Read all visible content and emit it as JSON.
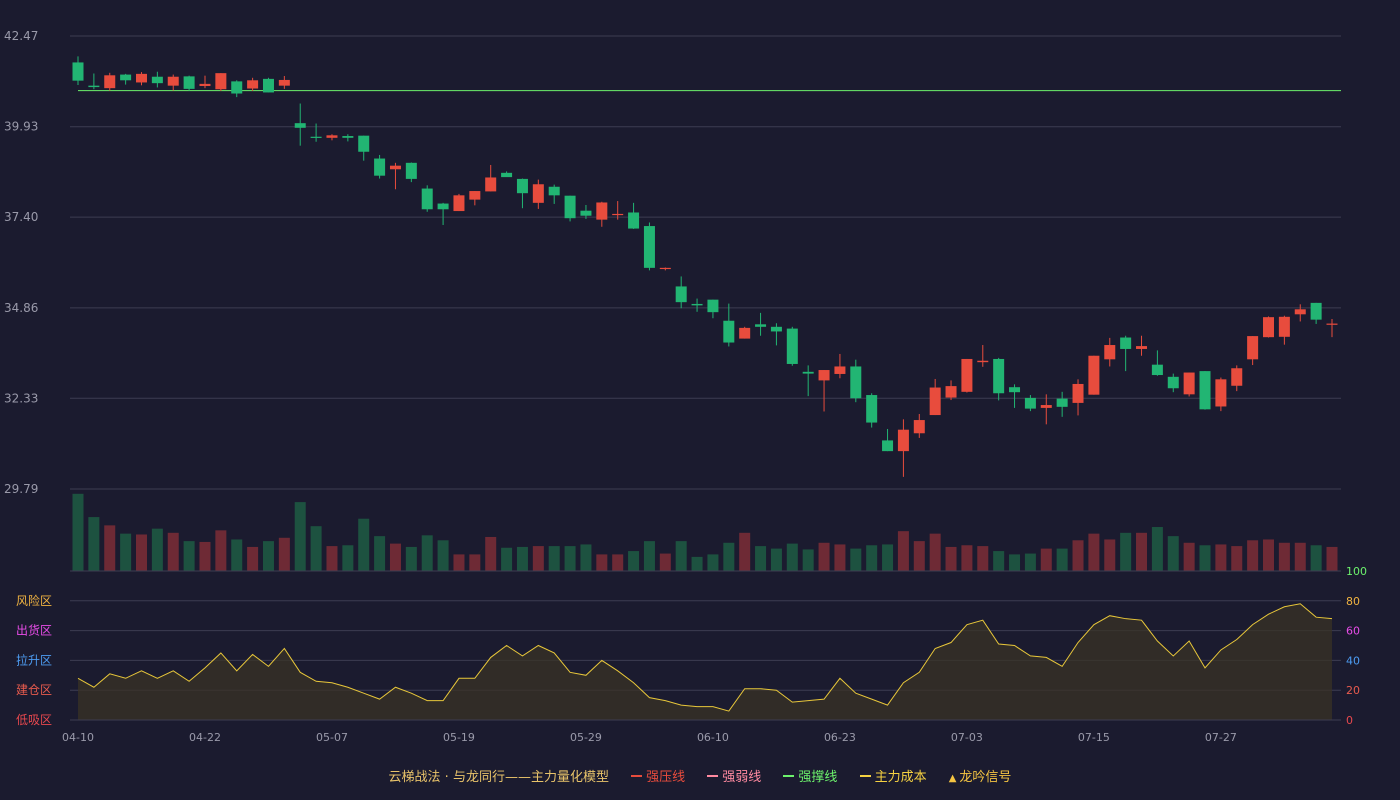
{
  "chart_data": {
    "type": "candlestick",
    "price_axis": {
      "ticks": [
        42.47,
        39.93,
        37.4,
        34.86,
        32.33,
        29.79
      ],
      "ylim": [
        29.79,
        42.47
      ]
    },
    "support_line": 40.94,
    "x_ticks": [
      "04-10",
      "04-22",
      "05-07",
      "05-19",
      "05-29",
      "06-10",
      "06-23",
      "07-03",
      "07-15",
      "07-27"
    ],
    "ohlc": [
      [
        41.73,
        41.22,
        41.9,
        41.1
      ],
      [
        41.08,
        41.04,
        41.42,
        40.98
      ],
      [
        41.01,
        41.37,
        41.44,
        40.94
      ],
      [
        41.39,
        41.23,
        41.41,
        41.11
      ],
      [
        41.17,
        41.41,
        41.46,
        41.09
      ],
      [
        41.33,
        41.15,
        41.47,
        41.03
      ],
      [
        41.08,
        41.33,
        41.39,
        40.94
      ],
      [
        41.34,
        40.99,
        41.36,
        40.94
      ],
      [
        41.07,
        41.13,
        41.36,
        41.01
      ],
      [
        40.98,
        41.43,
        41.43,
        40.93
      ],
      [
        41.2,
        40.86,
        41.23,
        40.76
      ],
      [
        41.0,
        41.23,
        41.3,
        40.93
      ],
      [
        41.27,
        40.89,
        41.3,
        40.89
      ],
      [
        41.08,
        41.24,
        41.35,
        40.99
      ],
      [
        40.03,
        39.9,
        40.58,
        39.4
      ],
      [
        39.65,
        39.62,
        40.02,
        39.51
      ],
      [
        39.62,
        39.69,
        39.72,
        39.55
      ],
      [
        39.67,
        39.62,
        39.72,
        39.52
      ],
      [
        39.68,
        39.23,
        39.68,
        38.98
      ],
      [
        39.04,
        38.56,
        39.14,
        38.48
      ],
      [
        38.74,
        38.84,
        38.92,
        38.18
      ],
      [
        38.92,
        38.47,
        38.93,
        38.38
      ],
      [
        38.2,
        37.62,
        38.29,
        37.55
      ],
      [
        37.78,
        37.62,
        37.8,
        37.18
      ],
      [
        37.57,
        38.01,
        38.05,
        37.57
      ],
      [
        37.89,
        38.13,
        38.13,
        37.73
      ],
      [
        38.12,
        38.51,
        38.86,
        38.12
      ],
      [
        38.64,
        38.52,
        38.68,
        38.54
      ],
      [
        38.47,
        38.07,
        38.48,
        37.65
      ],
      [
        37.8,
        38.32,
        38.45,
        37.63
      ],
      [
        38.25,
        38.01,
        38.31,
        37.77
      ],
      [
        38.0,
        37.37,
        38.0,
        37.28
      ],
      [
        37.58,
        37.44,
        37.74,
        37.35
      ],
      [
        37.33,
        37.81,
        37.83,
        37.13
      ],
      [
        37.49,
        37.49,
        37.85,
        37.33
      ],
      [
        37.53,
        37.08,
        37.8,
        37.07
      ],
      [
        37.15,
        35.98,
        37.25,
        35.91
      ],
      [
        35.98,
        35.98,
        35.99,
        35.91
      ],
      [
        35.46,
        35.02,
        35.74,
        34.85
      ],
      [
        34.97,
        34.93,
        35.12,
        34.75
      ],
      [
        35.09,
        34.74,
        35.09,
        34.57
      ],
      [
        34.5,
        33.89,
        34.98,
        33.78
      ],
      [
        34.0,
        34.3,
        34.33,
        34.0
      ],
      [
        34.4,
        34.33,
        34.72,
        34.08
      ],
      [
        34.33,
        34.2,
        34.43,
        33.81
      ],
      [
        34.28,
        33.29,
        34.33,
        33.24
      ],
      [
        33.07,
        33.02,
        33.25,
        32.39
      ],
      [
        32.83,
        33.12,
        33.12,
        31.96
      ],
      [
        33.01,
        33.22,
        33.57,
        32.89
      ],
      [
        33.22,
        32.33,
        33.41,
        32.22
      ],
      [
        32.42,
        31.65,
        32.47,
        31.51
      ],
      [
        31.15,
        30.85,
        31.47,
        30.85
      ],
      [
        30.85,
        31.45,
        31.74,
        30.13
      ],
      [
        31.35,
        31.72,
        31.89,
        31.22
      ],
      [
        31.86,
        32.63,
        32.87,
        31.86
      ],
      [
        32.35,
        32.67,
        32.83,
        32.28
      ],
      [
        32.51,
        33.43,
        33.43,
        32.49
      ],
      [
        33.34,
        33.38,
        33.82,
        33.21
      ],
      [
        33.43,
        32.47,
        33.46,
        32.27
      ],
      [
        32.64,
        32.5,
        32.72,
        32.06
      ],
      [
        32.34,
        32.04,
        32.42,
        31.97
      ],
      [
        32.06,
        32.14,
        32.44,
        31.6
      ],
      [
        32.32,
        32.09,
        32.51,
        31.81
      ],
      [
        32.2,
        32.73,
        32.86,
        31.85
      ],
      [
        32.43,
        33.52,
        33.52,
        32.43
      ],
      [
        33.42,
        33.82,
        34.02,
        33.22
      ],
      [
        34.03,
        33.71,
        34.08,
        33.09
      ],
      [
        33.71,
        33.79,
        34.08,
        33.52
      ],
      [
        33.27,
        32.98,
        33.67,
        32.96
      ],
      [
        32.93,
        32.61,
        33.02,
        32.5
      ],
      [
        32.44,
        33.05,
        33.05,
        32.38
      ],
      [
        33.09,
        32.02,
        33.09,
        32.01
      ],
      [
        32.1,
        32.86,
        32.91,
        31.97
      ],
      [
        32.68,
        33.17,
        33.25,
        32.53
      ],
      [
        33.42,
        34.07,
        34.07,
        33.26
      ],
      [
        34.04,
        34.6,
        34.62,
        34.03
      ],
      [
        34.05,
        34.61,
        34.64,
        33.83
      ],
      [
        34.68,
        34.82,
        34.96,
        34.48
      ],
      [
        35.0,
        34.53,
        35.0,
        34.41
      ],
      [
        34.41,
        34.42,
        34.55,
        34.04
      ]
    ],
    "volume": [
      0.93,
      0.65,
      0.55,
      0.45,
      0.44,
      0.51,
      0.46,
      0.36,
      0.35,
      0.49,
      0.38,
      0.29,
      0.36,
      0.4,
      0.83,
      0.54,
      0.3,
      0.31,
      0.63,
      0.42,
      0.33,
      0.29,
      0.43,
      0.37,
      0.2,
      0.2,
      0.41,
      0.28,
      0.29,
      0.3,
      0.3,
      0.3,
      0.32,
      0.2,
      0.2,
      0.24,
      0.36,
      0.21,
      0.36,
      0.17,
      0.2,
      0.34,
      0.46,
      0.3,
      0.27,
      0.33,
      0.26,
      0.34,
      0.32,
      0.27,
      0.31,
      0.32,
      0.48,
      0.36,
      0.45,
      0.29,
      0.31,
      0.3,
      0.24,
      0.2,
      0.21,
      0.27,
      0.27,
      0.37,
      0.45,
      0.38,
      0.46,
      0.46,
      0.53,
      0.42,
      0.34,
      0.31,
      0.32,
      0.3,
      0.37,
      0.38,
      0.34,
      0.34,
      0.31,
      0.29
    ],
    "indicator": [
      28,
      22,
      31,
      28,
      33,
      28,
      33,
      26,
      35,
      45,
      33,
      44,
      36,
      48,
      32,
      26,
      25,
      22,
      18,
      14,
      22,
      18,
      13,
      13,
      28,
      28,
      42,
      50,
      43,
      50,
      45,
      32,
      30,
      40,
      33,
      25,
      15,
      13,
      10,
      9,
      9,
      6,
      21,
      21,
      20,
      12,
      13,
      14,
      28,
      18,
      14,
      10,
      25,
      32,
      48,
      52,
      64,
      67,
      51,
      50,
      43,
      42,
      36,
      52,
      64,
      70,
      68,
      67,
      53,
      43,
      53,
      35,
      47,
      54,
      64,
      71,
      76,
      78,
      69,
      68
    ],
    "indicator_axis": {
      "ticks": [
        100,
        80,
        60,
        40,
        20,
        0
      ],
      "ylim": [
        0,
        100
      ]
    },
    "zones": [
      {
        "label": "风险区",
        "color": "#f0b341"
      },
      {
        "label": "出货区",
        "color": "#e84ce8"
      },
      {
        "label": "拉升区",
        "color": "#4d9cf2"
      },
      {
        "label": "建仓区",
        "color": "#e85b4e"
      },
      {
        "label": "低吸区",
        "color": "#e8484e"
      }
    ]
  },
  "legend": {
    "title": "云梯战法 · 与龙同行——主力量化模型",
    "items": [
      {
        "label": "强压线",
        "color": "#e84c3d",
        "style": "solid"
      },
      {
        "label": "强弱线",
        "color": "#ff8aa0",
        "style": "dashed"
      },
      {
        "label": "强撑线",
        "color": "#6cf26c",
        "style": "solid"
      },
      {
        "label": "主力成本",
        "color": "#f5d142",
        "style": "dashed"
      },
      {
        "label": "龙吟信号",
        "color": "#f5c542",
        "style": "triangle"
      }
    ]
  },
  "colors": {
    "up": "#e84c3d",
    "down": "#22b573",
    "vol_up": "#6e2a35",
    "vol_down": "#1d5240",
    "grid": "#3d3d52",
    "axis_text": "#9a9aaa",
    "line": "#e8c73a"
  }
}
